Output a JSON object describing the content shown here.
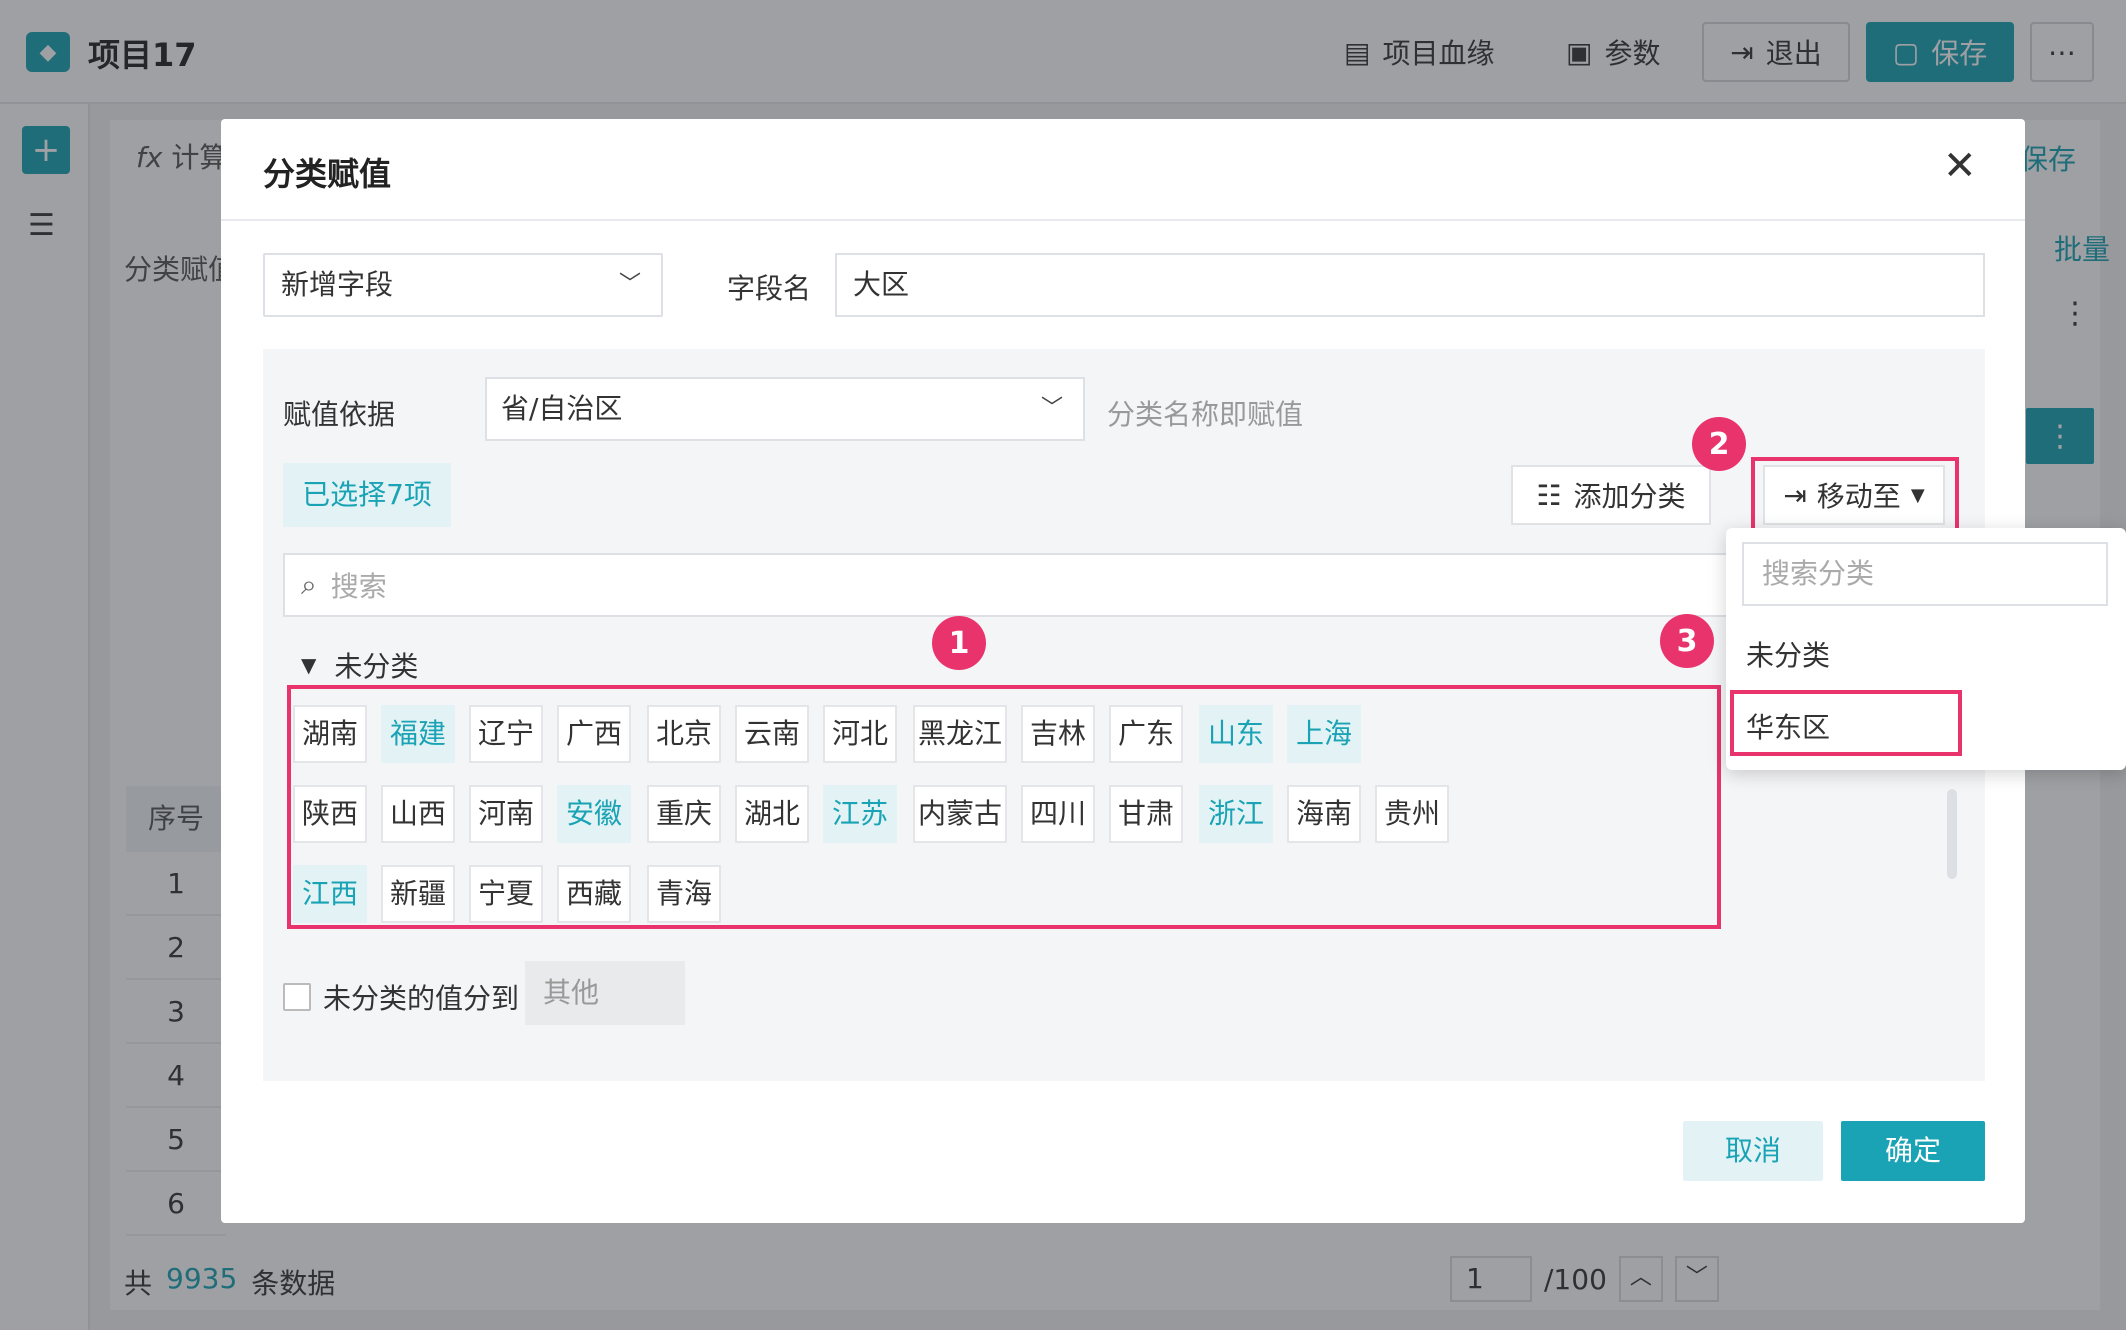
{
  "app": {
    "title": "项目17",
    "toolbar": {
      "lineage": "项目血缘",
      "params": "参数",
      "exit": "退出",
      "save": "保存"
    },
    "background": {
      "fx_label": "计算",
      "save_link": "保存",
      "left_label": "分类赋值",
      "batch_link": "批量",
      "table_header": "序号",
      "rows": [
        "1",
        "2",
        "3",
        "4",
        "5",
        "6"
      ],
      "footer_prefix": "共",
      "footer_count": "9935",
      "footer_suffix": "条数据",
      "page_current": "1",
      "page_total": "/100"
    }
  },
  "modal": {
    "title": "分类赋值",
    "field_type": "新增字段",
    "field_name_label": "字段名",
    "field_name_value": "大区",
    "basis_label": "赋值依据",
    "basis_value": "省/自治区",
    "basis_hint": "分类名称即赋值",
    "selected_badge": "已选择7项",
    "add_category": "添加分类",
    "move_to": "移动至",
    "search_placeholder": "搜索",
    "group_name": "未分类",
    "tags_row1": [
      {
        "label": "湖南",
        "selected": false
      },
      {
        "label": "福建",
        "selected": true
      },
      {
        "label": "辽宁",
        "selected": false
      },
      {
        "label": "广西",
        "selected": false
      },
      {
        "label": "北京",
        "selected": false
      },
      {
        "label": "云南",
        "selected": false
      },
      {
        "label": "河北",
        "selected": false
      },
      {
        "label": "黑龙江",
        "selected": false
      },
      {
        "label": "吉林",
        "selected": false
      },
      {
        "label": "广东",
        "selected": false
      },
      {
        "label": "山东",
        "selected": true
      },
      {
        "label": "上海",
        "selected": true
      }
    ],
    "tags_row2": [
      {
        "label": "陕西",
        "selected": false
      },
      {
        "label": "山西",
        "selected": false
      },
      {
        "label": "河南",
        "selected": false
      },
      {
        "label": "安徽",
        "selected": true
      },
      {
        "label": "重庆",
        "selected": false
      },
      {
        "label": "湖北",
        "selected": false
      },
      {
        "label": "江苏",
        "selected": true
      },
      {
        "label": "内蒙古",
        "selected": false
      },
      {
        "label": "四川",
        "selected": false
      },
      {
        "label": "甘肃",
        "selected": false
      },
      {
        "label": "浙江",
        "selected": true
      },
      {
        "label": "海南",
        "selected": false
      },
      {
        "label": "贵州",
        "selected": false
      }
    ],
    "tags_row3": [
      {
        "label": "江西",
        "selected": true
      },
      {
        "label": "新疆",
        "selected": false
      },
      {
        "label": "宁夏",
        "selected": false
      },
      {
        "label": "西藏",
        "selected": false
      },
      {
        "label": "青海",
        "selected": false
      }
    ],
    "uncategorized_label": "未分类的值分到",
    "uncategorized_value": "其他",
    "cancel": "取消",
    "confirm": "确定"
  },
  "dropdown": {
    "search_placeholder": "搜索分类",
    "items": [
      "未分类",
      "华东区"
    ]
  },
  "markers": [
    "1",
    "2",
    "3"
  ],
  "colors": {
    "accent": "#1aa3b5",
    "highlight": "#e8336d",
    "selected_bg": "#e3f3f5"
  }
}
